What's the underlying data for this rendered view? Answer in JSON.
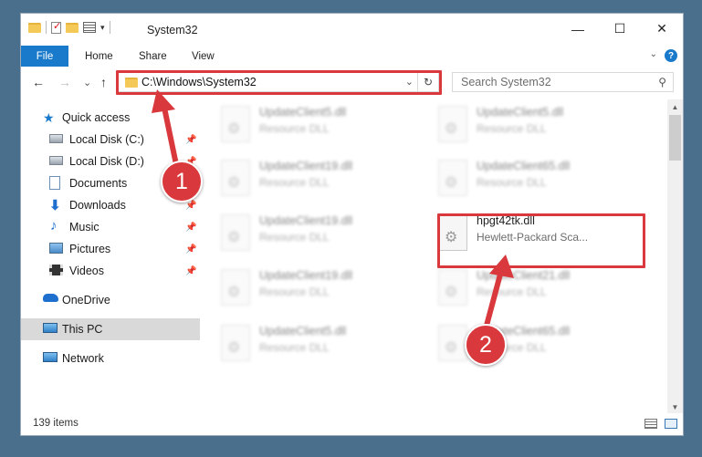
{
  "window": {
    "title": "System32",
    "controls": {
      "minimize": "—",
      "maximize": "☐",
      "close": "✕"
    }
  },
  "ribbon": {
    "tabs": [
      "File",
      "Home",
      "Share",
      "View"
    ],
    "help": "?"
  },
  "address_bar": {
    "path": "C:\\Windows\\System32",
    "dropdown": "⌄",
    "refresh": "↻"
  },
  "search": {
    "placeholder": "Search System32",
    "icon": "search-icon"
  },
  "nav_buttons": {
    "back": "←",
    "forward": "→",
    "recent": "⌄",
    "up": "↑"
  },
  "sidebar": {
    "items": [
      {
        "label": "Quick access",
        "icon": "star-icon",
        "pinned": false
      },
      {
        "label": "Local Disk (C:)",
        "icon": "drive-icon",
        "pinned": true
      },
      {
        "label": "Local Disk (D:)",
        "icon": "drive-icon",
        "pinned": true
      },
      {
        "label": "Documents",
        "icon": "documents-icon",
        "pinned": true
      },
      {
        "label": "Downloads",
        "icon": "download-icon",
        "pinned": true
      },
      {
        "label": "Music",
        "icon": "music-icon",
        "pinned": true
      },
      {
        "label": "Pictures",
        "icon": "pictures-icon",
        "pinned": true
      },
      {
        "label": "Videos",
        "icon": "videos-icon",
        "pinned": true
      },
      {
        "label": "OneDrive",
        "icon": "cloud-icon",
        "pinned": false
      },
      {
        "label": "This PC",
        "icon": "computer-icon",
        "pinned": false,
        "selected": true
      },
      {
        "label": "Network",
        "icon": "network-icon",
        "pinned": false
      }
    ]
  },
  "files": [
    {
      "name": "UpdateClient5.dll",
      "type": "Resource DLL",
      "blurred": true
    },
    {
      "name": "UpdateClient5.dll",
      "type": "Resource DLL",
      "blurred": true
    },
    {
      "name": "UpdateClient19.dll",
      "type": "Resource DLL",
      "blurred": true
    },
    {
      "name": "UpdateClient65.dll",
      "type": "Resource DLL",
      "blurred": true
    },
    {
      "name": "UpdateClient19.dll",
      "type": "Resource DLL",
      "blurred": true
    },
    {
      "name": "hpgt42tk.dll",
      "type": "Hewlett-Packard Sca...",
      "blurred": false
    },
    {
      "name": "UpdateClient19.dll",
      "type": "Resource DLL",
      "blurred": true
    },
    {
      "name": "UpdateClient21.dll",
      "type": "Resource DLL",
      "blurred": true
    },
    {
      "name": "UpdateClient5.dll",
      "type": "Resource DLL",
      "blurred": true
    },
    {
      "name": "UpdateClient65.dll",
      "type": "Resource DLL",
      "blurred": true
    }
  ],
  "status_bar": {
    "item_count": "139 items"
  },
  "annotations": {
    "step1": "1",
    "step2": "2",
    "color": "#d9383c"
  },
  "colors": {
    "accent": "#1979ca",
    "selection": "#d9d9d9"
  }
}
